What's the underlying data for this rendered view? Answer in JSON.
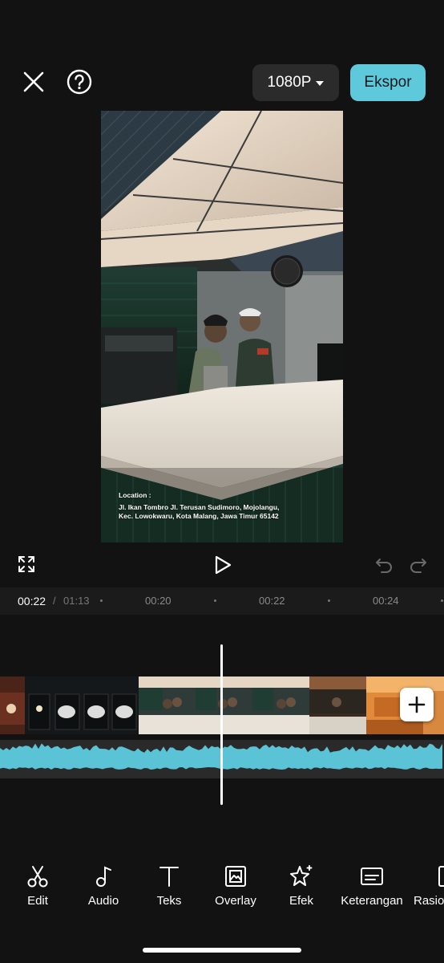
{
  "header": {
    "close_icon": "close-icon",
    "help_icon": "question-mark-icon",
    "resolution": "1080P",
    "export_label": "Ekspor"
  },
  "preview": {
    "caption_title": "Location :",
    "caption_address": "Jl. Ikan Tombro Jl. Terusan Sudimoro, Mojolangu,\nKec. Lowokwaru, Kota Malang, Jawa Timur 65142"
  },
  "player": {
    "fullscreen_icon": "expand-icon",
    "play_icon": "play-icon",
    "undo_icon": "undo-icon",
    "redo_icon": "redo-icon"
  },
  "timeline": {
    "current_time": "00:22",
    "separator": "/",
    "total_time": "01:13",
    "ticks": [
      "00:20",
      "00:22",
      "00:24"
    ],
    "add_clip_icon": "plus-icon"
  },
  "toolbar": {
    "items": [
      {
        "label": "Edit",
        "icon": "scissors-icon"
      },
      {
        "label": "Audio",
        "icon": "music-note-icon"
      },
      {
        "label": "Teks",
        "icon": "text-icon"
      },
      {
        "label": "Overlay",
        "icon": "overlay-icon"
      },
      {
        "label": "Efek",
        "icon": "sparkle-star-icon"
      },
      {
        "label": "Keterangan",
        "icon": "captions-icon"
      },
      {
        "label": "Rasio",
        "icon": "ratio-icon"
      }
    ]
  },
  "colors": {
    "background": "#121212",
    "accent": "#5fc9dc",
    "waveform": "#5bc3d6"
  }
}
